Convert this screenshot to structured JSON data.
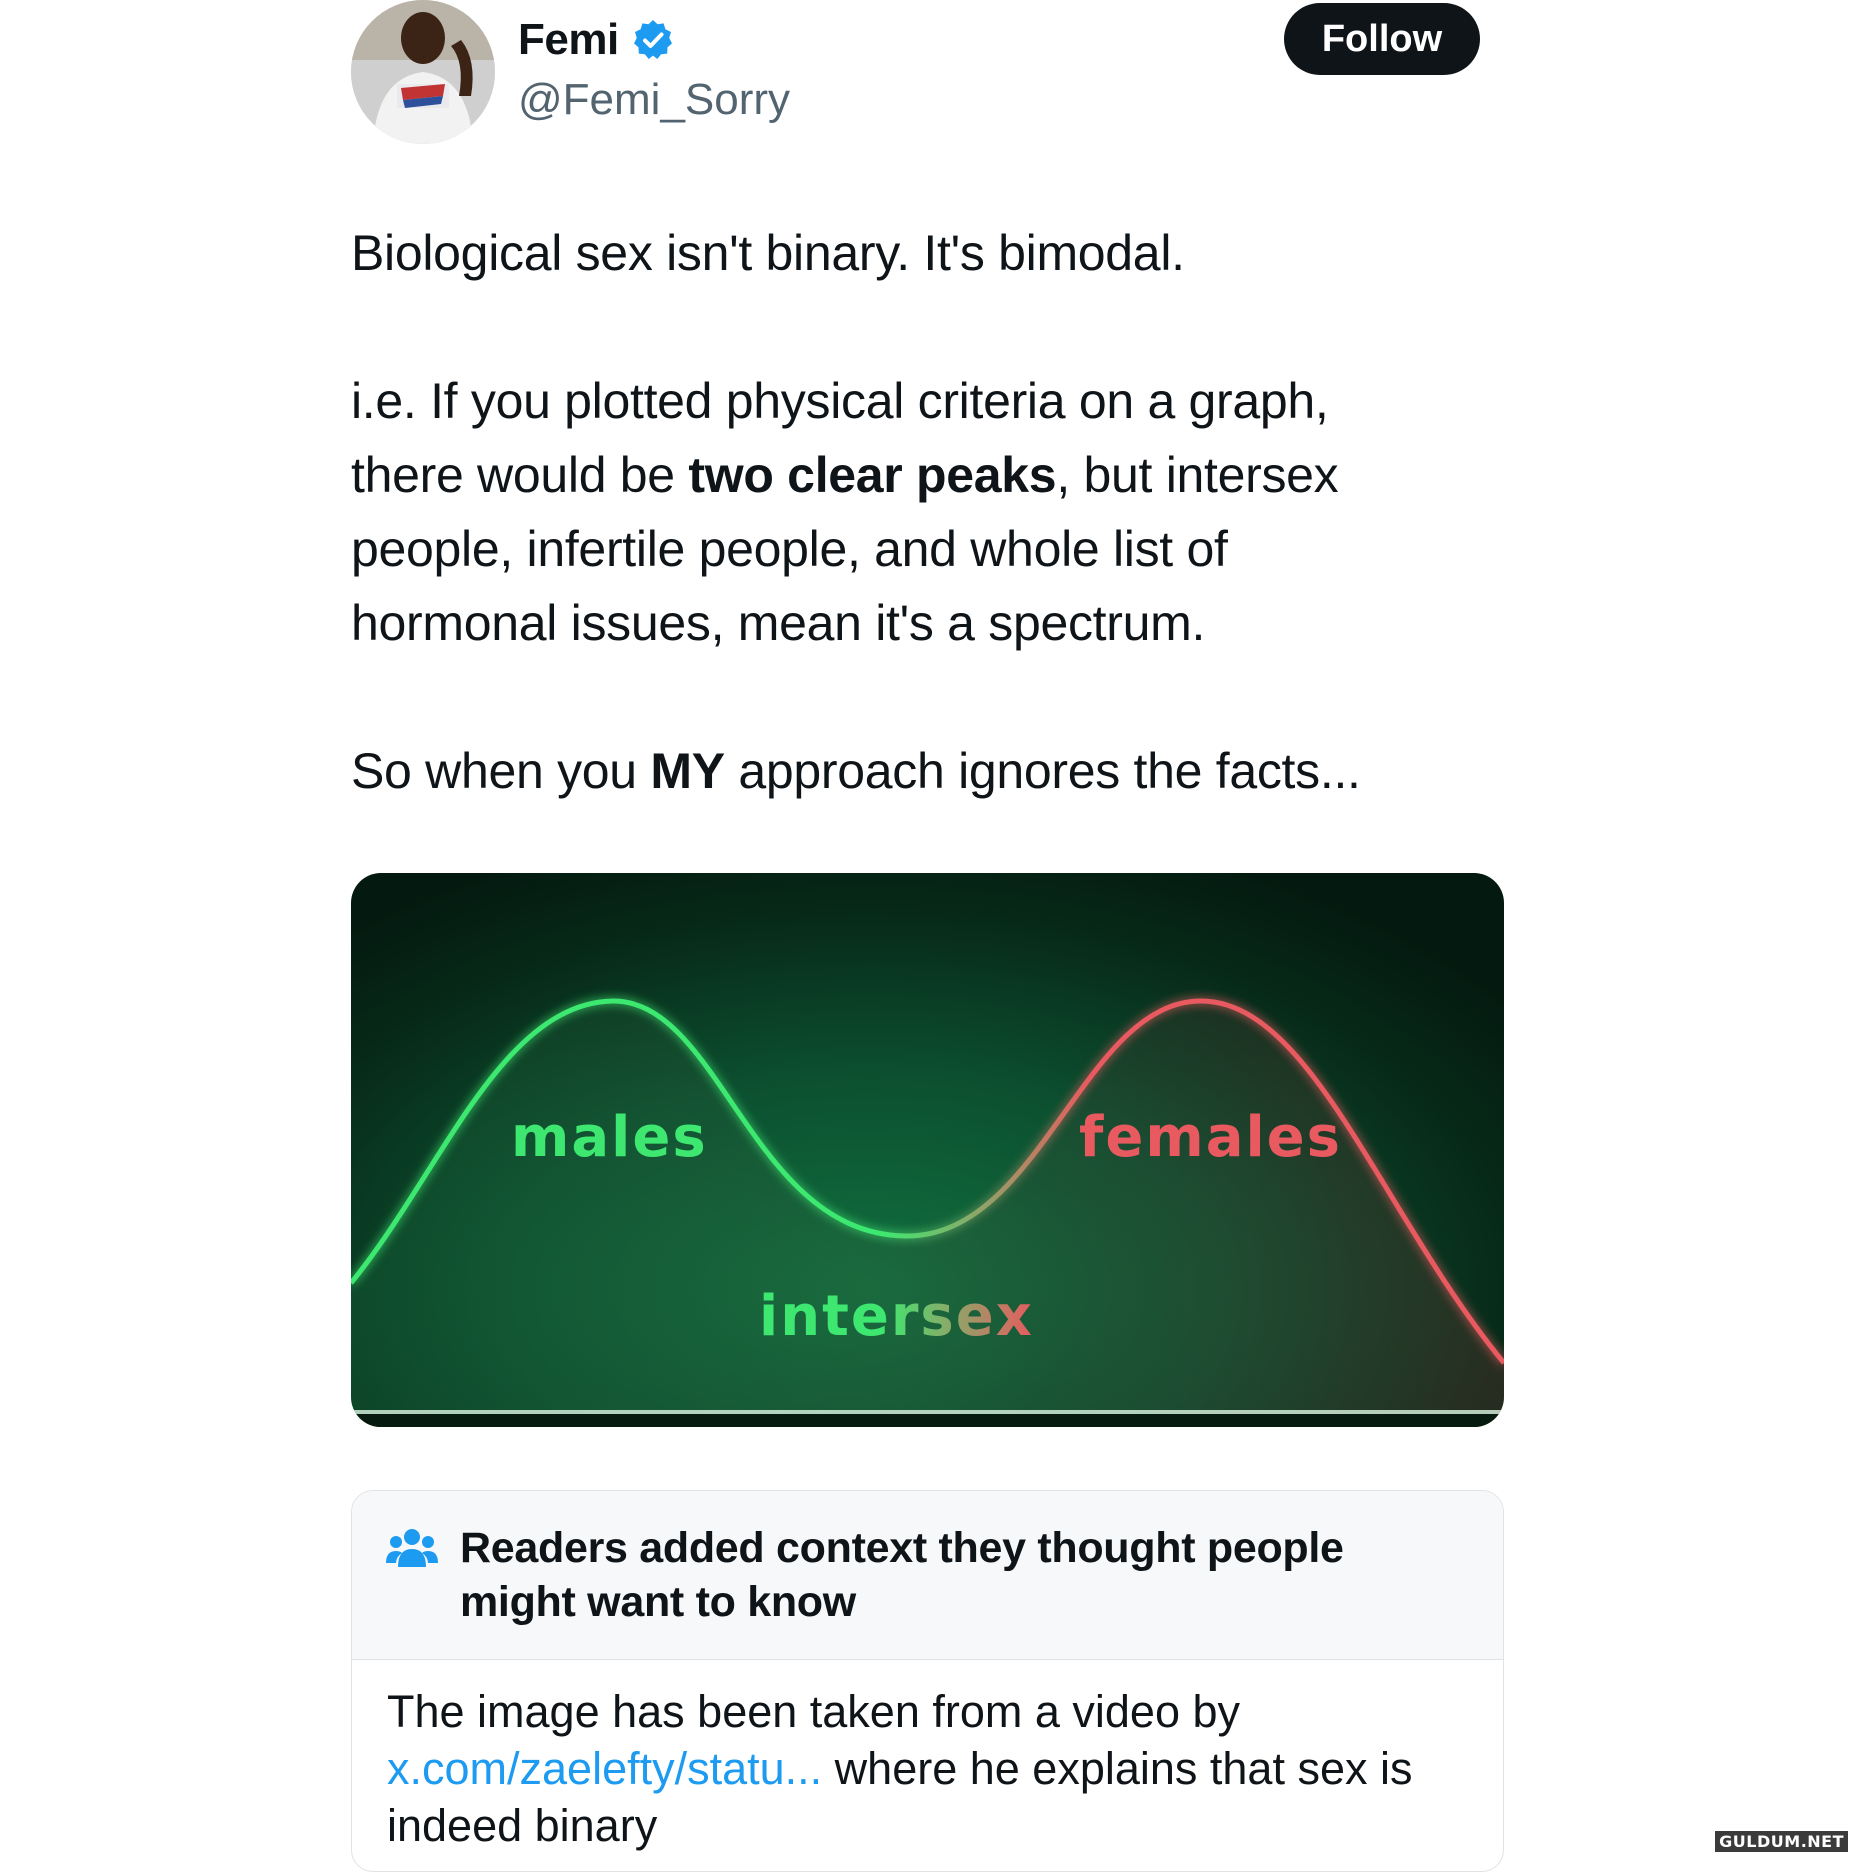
{
  "author": {
    "display_name": "Femi",
    "handle": "@Femi_Sorry",
    "verified": true,
    "avatar_icon": "user-photo"
  },
  "actions": {
    "follow_label": "Follow"
  },
  "tweet": {
    "line1": "Biological sex isn't binary. It's bimodal.",
    "line2": "i.e. If you plotted physical criteria on a graph,",
    "line3_pre": "there would be ",
    "line3_bold": "two clear peaks",
    "line3_post": ", but intersex",
    "line4": "people, infertile people, and whole list of",
    "line5": "hormonal issues, mean it's a spectrum.",
    "line6_pre": "So when you ",
    "line6_bold": "MY",
    "line6_post": " approach ignores the facts..."
  },
  "media": {
    "labels": {
      "males": "males",
      "females": "females",
      "intersex": "intersex"
    },
    "colors": {
      "male": "#3ee870",
      "female": "#e85a5f",
      "background": "#0c5030"
    }
  },
  "note": {
    "icon": "people-icon",
    "title": "Readers added context they thought people might want to know",
    "body_pre": "The image has been taken from a video by ",
    "body_link": "x.com/zaelefty/statu...",
    "body_post": " where he explains that sex is indeed binary",
    "link_color": "#1d9bf0"
  },
  "watermark": "GULDUM.NET"
}
